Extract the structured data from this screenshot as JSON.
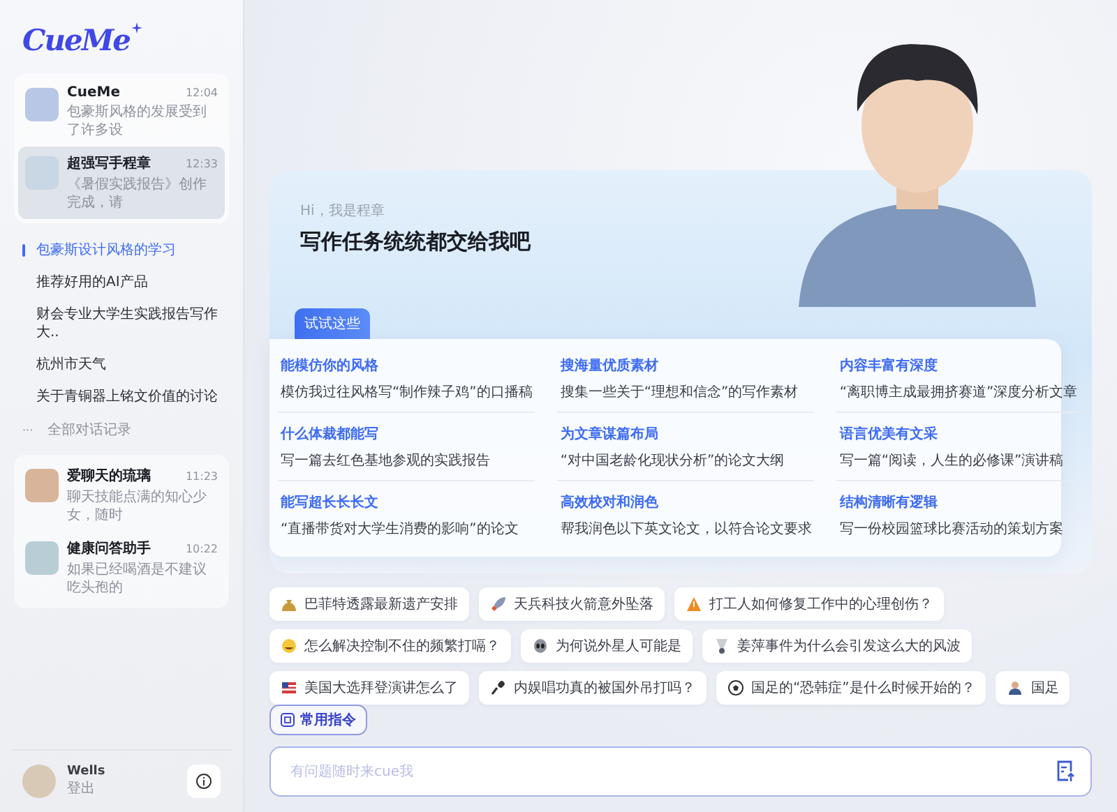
{
  "logo": {
    "text": "CueMe"
  },
  "pinned_agents": [
    {
      "name": "CueMe",
      "time": "12:04",
      "preview": "包豪斯风格的发展受到了许多设",
      "selected": false
    },
    {
      "name": "超强写手程章",
      "time": "12:33",
      "preview": "《暑假实践报告》创作完成，请",
      "selected": true
    }
  ],
  "history": {
    "items": [
      {
        "label": "包豪斯设计风格的学习",
        "selected": true
      },
      {
        "label": "推荐好用的AI产品",
        "selected": false
      },
      {
        "label": "财会专业大学生实践报告写作大..",
        "selected": false
      },
      {
        "label": "杭州市天气",
        "selected": false
      },
      {
        "label": "关于青铜器上铭文价值的讨论",
        "selected": false
      }
    ],
    "all_link": {
      "icon": "···",
      "label": "全部对话记录"
    }
  },
  "more_agents": [
    {
      "name": "爱聊天的琉璃",
      "time": "11:23",
      "preview": "聊天技能点满的知心少女，随时",
      "selected": false
    },
    {
      "name": "健康问答助手",
      "time": "10:22",
      "preview": "如果已经喝酒是不建议吃头孢的",
      "selected": false
    }
  ],
  "user": {
    "name": "Wells",
    "action": "登出"
  },
  "hero": {
    "greeting": "Hi，我是程章",
    "headline": "写作任务统统都交给我吧",
    "tag": "试试这些",
    "suggestions": [
      {
        "title": "能模仿你的风格",
        "prompt": "模仿我过往风格写“制作辣子鸡”的口播稿"
      },
      {
        "title": "搜海量优质素材",
        "prompt": "搜集一些关于“理想和信念”的写作素材"
      },
      {
        "title": "内容丰富有深度",
        "prompt": "“离职博主成最拥挤赛道”深度分析文章"
      },
      {
        "title": "什么体裁都能写",
        "prompt": "写一篇去红色基地参观的实践报告"
      },
      {
        "title": "为文章谋篇布局",
        "prompt": "“对中国老龄化现状分析”的论文大纲"
      },
      {
        "title": "语言优美有文采",
        "prompt": "写一篇“阅读，人生的必修课”演讲稿"
      },
      {
        "title": "能写超长长长文",
        "prompt": "“直播带货对大学生消费的影响”的论文"
      },
      {
        "title": "高效校对和润色",
        "prompt": "帮我润色以下英文论文，以符合论文要求"
      },
      {
        "title": "结构清晰有逻辑",
        "prompt": "写一份校园篮球比赛活动的策划方案"
      }
    ]
  },
  "quick_questions": [
    {
      "kind": "money-bag",
      "text": "巴菲特透露最新遗产安排"
    },
    {
      "kind": "rocket",
      "text": "天兵科技火箭意外坠落"
    },
    {
      "kind": "warning",
      "text": "打工人如何修复工作中的心理创伤？"
    },
    {
      "kind": "laughing",
      "text": "怎么解决控制不住的频繁打嗝？"
    },
    {
      "kind": "alien",
      "text": "为何说外星人可能是"
    },
    {
      "kind": "shuttlecock",
      "text": "姜萍事件为什么会引发这么大的风波"
    },
    {
      "kind": "flag",
      "text": "美国大选拜登演讲怎么了"
    },
    {
      "kind": "microphone",
      "text": "内娱唱功真的被国外吊打吗？"
    },
    {
      "kind": "soccer-ball",
      "text": "国足的“恐韩症”是什么时候开始的？"
    },
    {
      "kind": "person",
      "text": "国足"
    }
  ],
  "command_button": {
    "label": "常用指令"
  },
  "input": {
    "placeholder": "有问题随时来cue我"
  }
}
